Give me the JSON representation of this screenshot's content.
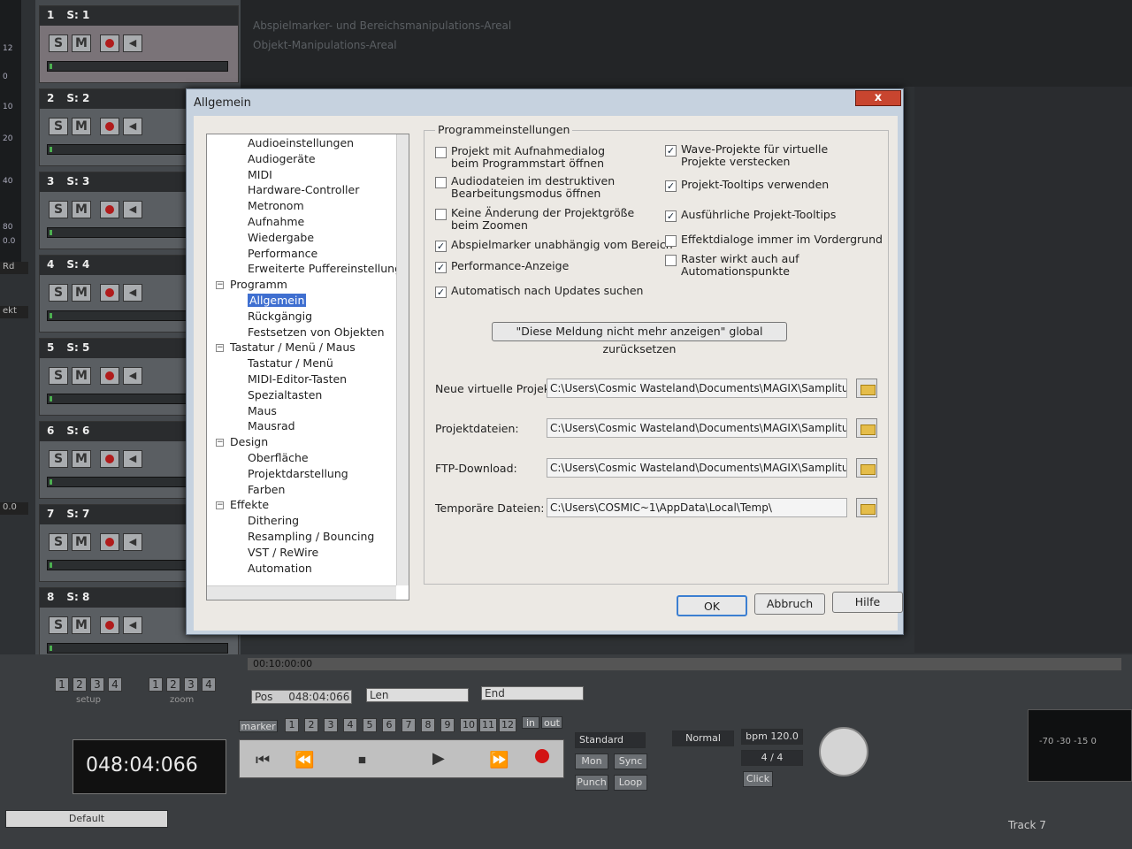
{
  "arrange": {
    "line1": "Abspielmarker- und Bereichsmanipulations-Areal",
    "line2": "Objekt-Manipulations-Areal"
  },
  "meter_ticks": [
    "12",
    "0",
    "10",
    "20",
    "40",
    "80",
    "0.0"
  ],
  "side_labels": [
    "Rd",
    "ekt",
    "0.0"
  ],
  "tracks": [
    {
      "num": "1",
      "name": "S: 1"
    },
    {
      "num": "2",
      "name": "S: 2"
    },
    {
      "num": "3",
      "name": "S: 3"
    },
    {
      "num": "4",
      "name": "S: 4"
    },
    {
      "num": "5",
      "name": "S: 5"
    },
    {
      "num": "6",
      "name": "S: 6"
    },
    {
      "num": "7",
      "name": "S: 7"
    },
    {
      "num": "8",
      "name": "S: 8"
    }
  ],
  "track_buttons": {
    "solo": "S",
    "mute": "M"
  },
  "dialog": {
    "title": "Allgemein",
    "close": "x",
    "tree": [
      {
        "label": "Audioeinstellungen",
        "level": 2
      },
      {
        "label": "Audiogeräte",
        "level": 2
      },
      {
        "label": "MIDI",
        "level": 2
      },
      {
        "label": "Hardware-Controller",
        "level": 2
      },
      {
        "label": "Metronom",
        "level": 2
      },
      {
        "label": "Aufnahme",
        "level": 2
      },
      {
        "label": "Wiedergabe",
        "level": 2
      },
      {
        "label": "Performance",
        "level": 2
      },
      {
        "label": "Erweiterte Puffereinstellungen",
        "level": 2
      },
      {
        "label": "Programm",
        "level": 1
      },
      {
        "label": "Allgemein",
        "level": 2,
        "selected": true
      },
      {
        "label": "Rückgängig",
        "level": 2
      },
      {
        "label": "Festsetzen von Objekten",
        "level": 2
      },
      {
        "label": "Tastatur / Menü / Maus",
        "level": 1
      },
      {
        "label": "Tastatur / Menü",
        "level": 2
      },
      {
        "label": "MIDI-Editor-Tasten",
        "level": 2
      },
      {
        "label": "Spezialtasten",
        "level": 2
      },
      {
        "label": "Maus",
        "level": 2
      },
      {
        "label": "Mausrad",
        "level": 2
      },
      {
        "label": "Design",
        "level": 1
      },
      {
        "label": "Oberfläche",
        "level": 2
      },
      {
        "label": "Projektdarstellung",
        "level": 2
      },
      {
        "label": "Farben",
        "level": 2
      },
      {
        "label": "Effekte",
        "level": 1
      },
      {
        "label": "Dithering",
        "level": 2
      },
      {
        "label": "Resampling / Bouncing",
        "level": 2
      },
      {
        "label": "VST / ReWire",
        "level": 2
      },
      {
        "label": "Automation",
        "level": 2
      }
    ],
    "group_title": "Programmeinstellungen",
    "checks_left": [
      {
        "label": "Projekt mit Aufnahmedialog\nbeim Programmstart öffnen",
        "checked": false
      },
      {
        "label": "Audiodateien im destruktiven\nBearbeitungsmodus öffnen",
        "checked": false
      },
      {
        "label": "Keine Änderung der Projektgröße\nbeim Zoomen",
        "checked": false
      },
      {
        "label": "Abspielmarker unabhängig vom Bereich",
        "checked": true
      },
      {
        "label": "Performance-Anzeige",
        "checked": true
      },
      {
        "label": "Automatisch nach Updates suchen",
        "checked": true
      }
    ],
    "checks_right": [
      {
        "label": "Wave-Projekte für virtuelle\nProjekte verstecken",
        "checked": true
      },
      {
        "label": "Projekt-Tooltips verwenden",
        "checked": true
      },
      {
        "label": "Ausführliche Projekt-Tooltips",
        "checked": true
      },
      {
        "label": "Effektdialoge immer im Vordergrund",
        "checked": false
      },
      {
        "label": "Raster wirkt auch auf\nAutomationspunkte",
        "checked": false
      }
    ],
    "reset_button": "\"Diese Meldung nicht mehr anzeigen\" global zurücksetzen",
    "paths": [
      {
        "label": "Neue virtuelle Projekte:",
        "value": "C:\\Users\\Cosmic Wasteland\\Documents\\MAGIX\\Samplitude Pr"
      },
      {
        "label": "Projektdateien:",
        "value": "C:\\Users\\Cosmic Wasteland\\Documents\\MAGIX\\Samplitude Pr"
      },
      {
        "label": "FTP-Download:",
        "value": "C:\\Users\\Cosmic Wasteland\\Documents\\MAGIX\\Samplitude Pr"
      },
      {
        "label": "Temporäre Dateien:",
        "value": "C:\\Users\\COSMIC~1\\AppData\\Local\\Temp\\"
      }
    ],
    "ok": "OK",
    "cancel": "Abbruch",
    "help": "Hilfe"
  },
  "transport": {
    "time": "00:10:00:00",
    "pos_label": "Pos",
    "pos_value": "048:04:066",
    "len_label": "Len",
    "end_label": "End",
    "counter": "048:04:066",
    "marker_label": "marker",
    "markers": [
      "1",
      "2",
      "3",
      "4",
      "5",
      "6",
      "7",
      "8",
      "9",
      "10",
      "11",
      "12"
    ],
    "in_label": "in",
    "out_label": "out",
    "setup_label": "setup",
    "zoom_label": "zoom",
    "setup_nums": [
      "1",
      "2",
      "3",
      "4"
    ],
    "zoom_nums": [
      "1",
      "2",
      "3",
      "4"
    ],
    "mode": "Standard",
    "mon": "Mon",
    "sync": "Sync",
    "punch": "Punch",
    "loop": "Loop",
    "normal": "Normal",
    "bpm": "bpm 120.0",
    "signature": "4 / 4",
    "click": "Click",
    "default": "Default",
    "track_name": "Track 7",
    "meter_labels": "-70 -30 -15 0"
  }
}
